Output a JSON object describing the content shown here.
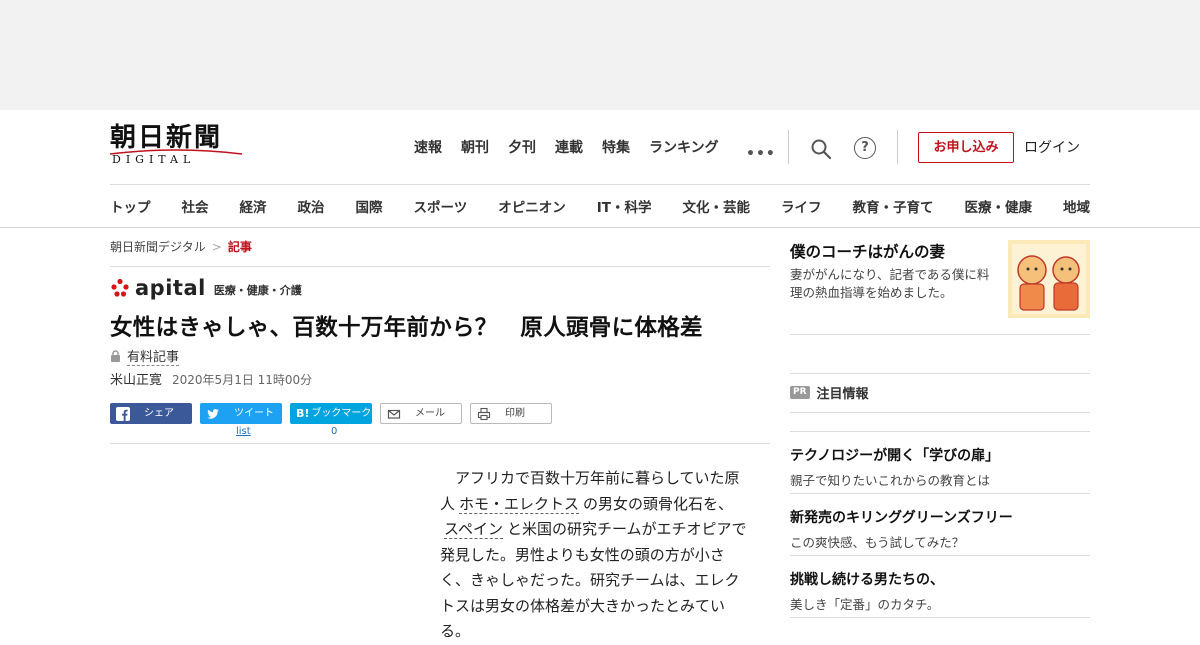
{
  "site": {
    "logo_main": "朝日新聞",
    "logo_sub": "DIGITAL"
  },
  "top_nav": [
    "速報",
    "朝刊",
    "夕刊",
    "連載",
    "特集",
    "ランキング"
  ],
  "header_actions": {
    "more_icon": "•••",
    "help_icon": "?",
    "apply_label": "お申し込み",
    "login_label": "ログイン"
  },
  "categories": [
    "トップ",
    "社会",
    "経済",
    "政治",
    "国際",
    "スポーツ",
    "オピニオン",
    "IT・科学",
    "文化・芸能",
    "ライフ",
    "教育・子育て",
    "医療・健康",
    "地域"
  ],
  "breadcrumb": {
    "home": "朝日新聞デジタル",
    "separator": ">",
    "current": "記事"
  },
  "section": {
    "brand": "apital",
    "category": "医療・健康・介護"
  },
  "article": {
    "headline": "女性はきゃしゃ、百数十万年前から？　原人頭骨に体格差",
    "paid_label": "有料記事",
    "author": "米山正寛",
    "date": "2020年5月1日 11時00分",
    "body_lead": "アフリカで百数十万年前に暮らしていた原人",
    "body_link1": "ホモ・エレクトス",
    "body_mid1": "の男女の頭骨化石を、",
    "body_link2": "スペイン",
    "body_rest": "と米国の研究チームがエチオピアで発見した。男性よりも女性の頭の方が小さく、きゃしゃだった。研究チームは、エレクトスは男女の体格差が大きかったとみている。"
  },
  "share": {
    "facebook": "シェア",
    "twitter": "ツイート",
    "hatena": "ブックマーク",
    "hatena_glyph": "B!",
    "mail": "メール",
    "print": "印刷",
    "twitter_count": "list",
    "hatena_count": "0"
  },
  "sidebar": {
    "promo_title": "僕のコーチはがんの妻",
    "promo_desc": "妻ががんになり、記者である僕に料理の熱血指導を始めました。",
    "pr_badge": "PR",
    "pr_heading": "注目情報",
    "pr_items": [
      {
        "title": "テクノロジーが開く「学びの扉」",
        "desc": "親子で知りたいこれからの教育とは"
      },
      {
        "title": "新発売のキリンググリーンズフリー",
        "desc": "この爽快感、もう試してみた？"
      },
      {
        "title": "挑戦し続ける男たちの、",
        "desc": "美しき「定番」のカタチ。"
      }
    ]
  },
  "colors": {
    "accent_red": "#c0121c",
    "facebook": "#3b5998",
    "twitter": "#1da1f2",
    "hatena": "#00a4de"
  }
}
